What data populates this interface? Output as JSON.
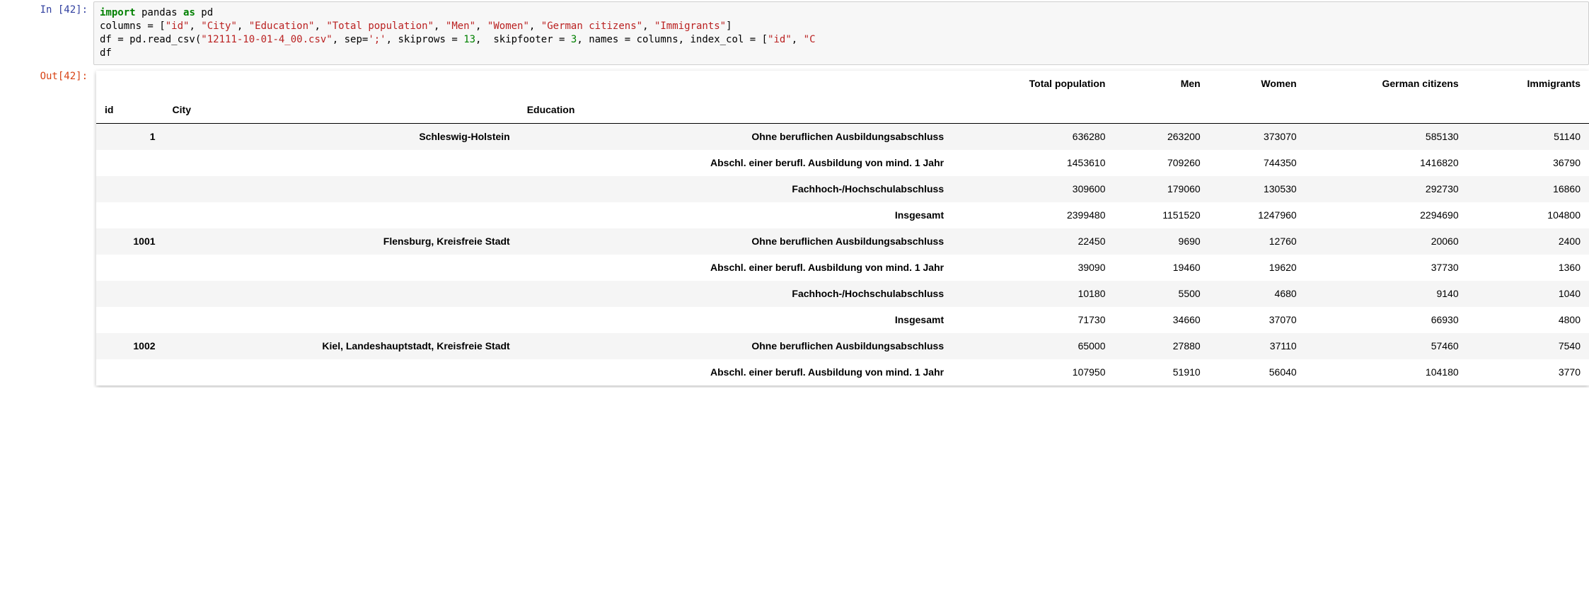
{
  "cell": {
    "in_prompt": "In [42]:",
    "out_prompt": "Out[42]:",
    "code": {
      "l1_import": "import",
      "l1_pandas": " pandas ",
      "l1_as": "as",
      "l1_pd": " pd",
      "l2_pre": "columns = [",
      "l2_s1": "\"id\"",
      "l2_s2": "\"City\"",
      "l2_s3": "\"Education\"",
      "l2_s4": "\"Total population\"",
      "l2_s5": "\"Men\"",
      "l2_s6": "\"Women\"",
      "l2_s7": "\"German citizens\"",
      "l2_s8": "\"Immigrants\"",
      "l2_post": "]",
      "l3_a": "df = pd.read_csv(",
      "l3_fname": "\"12111-10-01-4_00.csv\"",
      "l3_b": ", sep=",
      "l3_sep": "';'",
      "l3_c": ", skiprows = ",
      "l3_skiprows": "13",
      "l3_d": ",  skipfooter = ",
      "l3_skipfooter": "3",
      "l3_e": ", names = columns, index_col = [",
      "l3_idx1": "\"id\"",
      "l3_f": ", ",
      "l3_idx2": "\"C",
      "l4": "df"
    }
  },
  "table": {
    "columns": [
      "Total population",
      "Men",
      "Women",
      "German citizens",
      "Immigrants"
    ],
    "index_names": [
      "id",
      "City",
      "Education"
    ],
    "groups": [
      {
        "id": "1",
        "city": "Schleswig-Holstein",
        "rows": [
          {
            "edu": "Ohne beruflichen Ausbildungsabschluss",
            "vals": [
              "636280",
              "263200",
              "373070",
              "585130",
              "51140"
            ]
          },
          {
            "edu": "Abschl. einer berufl. Ausbildung von mind. 1 Jahr",
            "vals": [
              "1453610",
              "709260",
              "744350",
              "1416820",
              "36790"
            ]
          },
          {
            "edu": "Fachhoch-/Hochschulabschluss",
            "vals": [
              "309600",
              "179060",
              "130530",
              "292730",
              "16860"
            ]
          },
          {
            "edu": "Insgesamt",
            "vals": [
              "2399480",
              "1151520",
              "1247960",
              "2294690",
              "104800"
            ]
          }
        ]
      },
      {
        "id": "1001",
        "city": "Flensburg, Kreisfreie Stadt",
        "rows": [
          {
            "edu": "Ohne beruflichen Ausbildungsabschluss",
            "vals": [
              "22450",
              "9690",
              "12760",
              "20060",
              "2400"
            ]
          },
          {
            "edu": "Abschl. einer berufl. Ausbildung von mind. 1 Jahr",
            "vals": [
              "39090",
              "19460",
              "19620",
              "37730",
              "1360"
            ]
          },
          {
            "edu": "Fachhoch-/Hochschulabschluss",
            "vals": [
              "10180",
              "5500",
              "4680",
              "9140",
              "1040"
            ]
          },
          {
            "edu": "Insgesamt",
            "vals": [
              "71730",
              "34660",
              "37070",
              "66930",
              "4800"
            ]
          }
        ]
      },
      {
        "id": "1002",
        "city": "Kiel, Landeshauptstadt, Kreisfreie Stadt",
        "rows": [
          {
            "edu": "Ohne beruflichen Ausbildungsabschluss",
            "vals": [
              "65000",
              "27880",
              "37110",
              "57460",
              "7540"
            ]
          },
          {
            "edu": "Abschl. einer berufl. Ausbildung von mind. 1 Jahr",
            "vals": [
              "107950",
              "51910",
              "56040",
              "104180",
              "3770"
            ]
          }
        ]
      }
    ]
  }
}
